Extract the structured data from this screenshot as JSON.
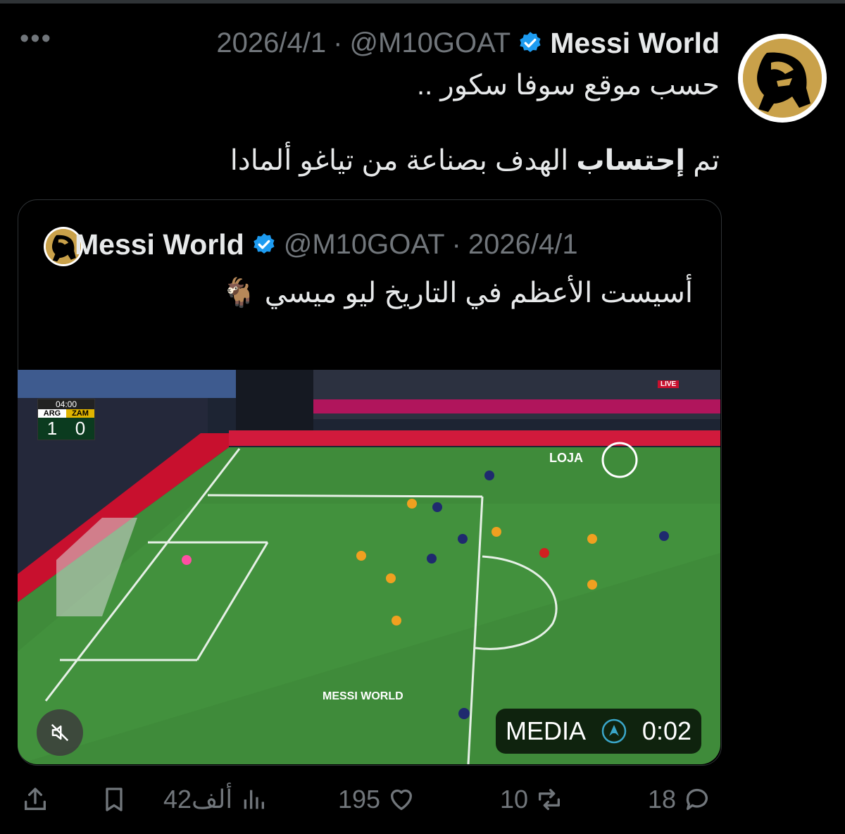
{
  "post": {
    "author_name": "Messi World",
    "handle": "@M10GOAT",
    "separator": "·",
    "date": "2026/4/1",
    "text_line1": "حسب موقع سوفا سكور ..",
    "text_line2_prefix": "تم ",
    "text_line2_bold": "إحتساب",
    "text_line2_suffix": " الهدف بصناعة من تياغو ألمادا"
  },
  "quote": {
    "author_name": "Messi World",
    "handle": "@M10GOAT",
    "separator": "·",
    "date": "2026/4/1",
    "text": "أسيست الأعظم في التاريخ ليو ميسي 🐐"
  },
  "media": {
    "label": "MEDIA",
    "duration": "0:02",
    "watermark": "MESSI WORLD",
    "scoreboard": {
      "clock": "04:00",
      "home": "ARG",
      "away": "ZAM",
      "home_score": "1",
      "away_score": "0"
    },
    "broadcaster_logo": "LOJA",
    "live_badge": "LIVE"
  },
  "actions": {
    "replies": "18",
    "reposts": "10",
    "likes": "195",
    "views": "42ألف"
  },
  "colors": {
    "background": "#000000",
    "text": "#e7e9ea",
    "muted": "#71767b",
    "verified": "#1d9bf0",
    "gold": "#c9a14a",
    "pitch": "#3f8b3a"
  }
}
